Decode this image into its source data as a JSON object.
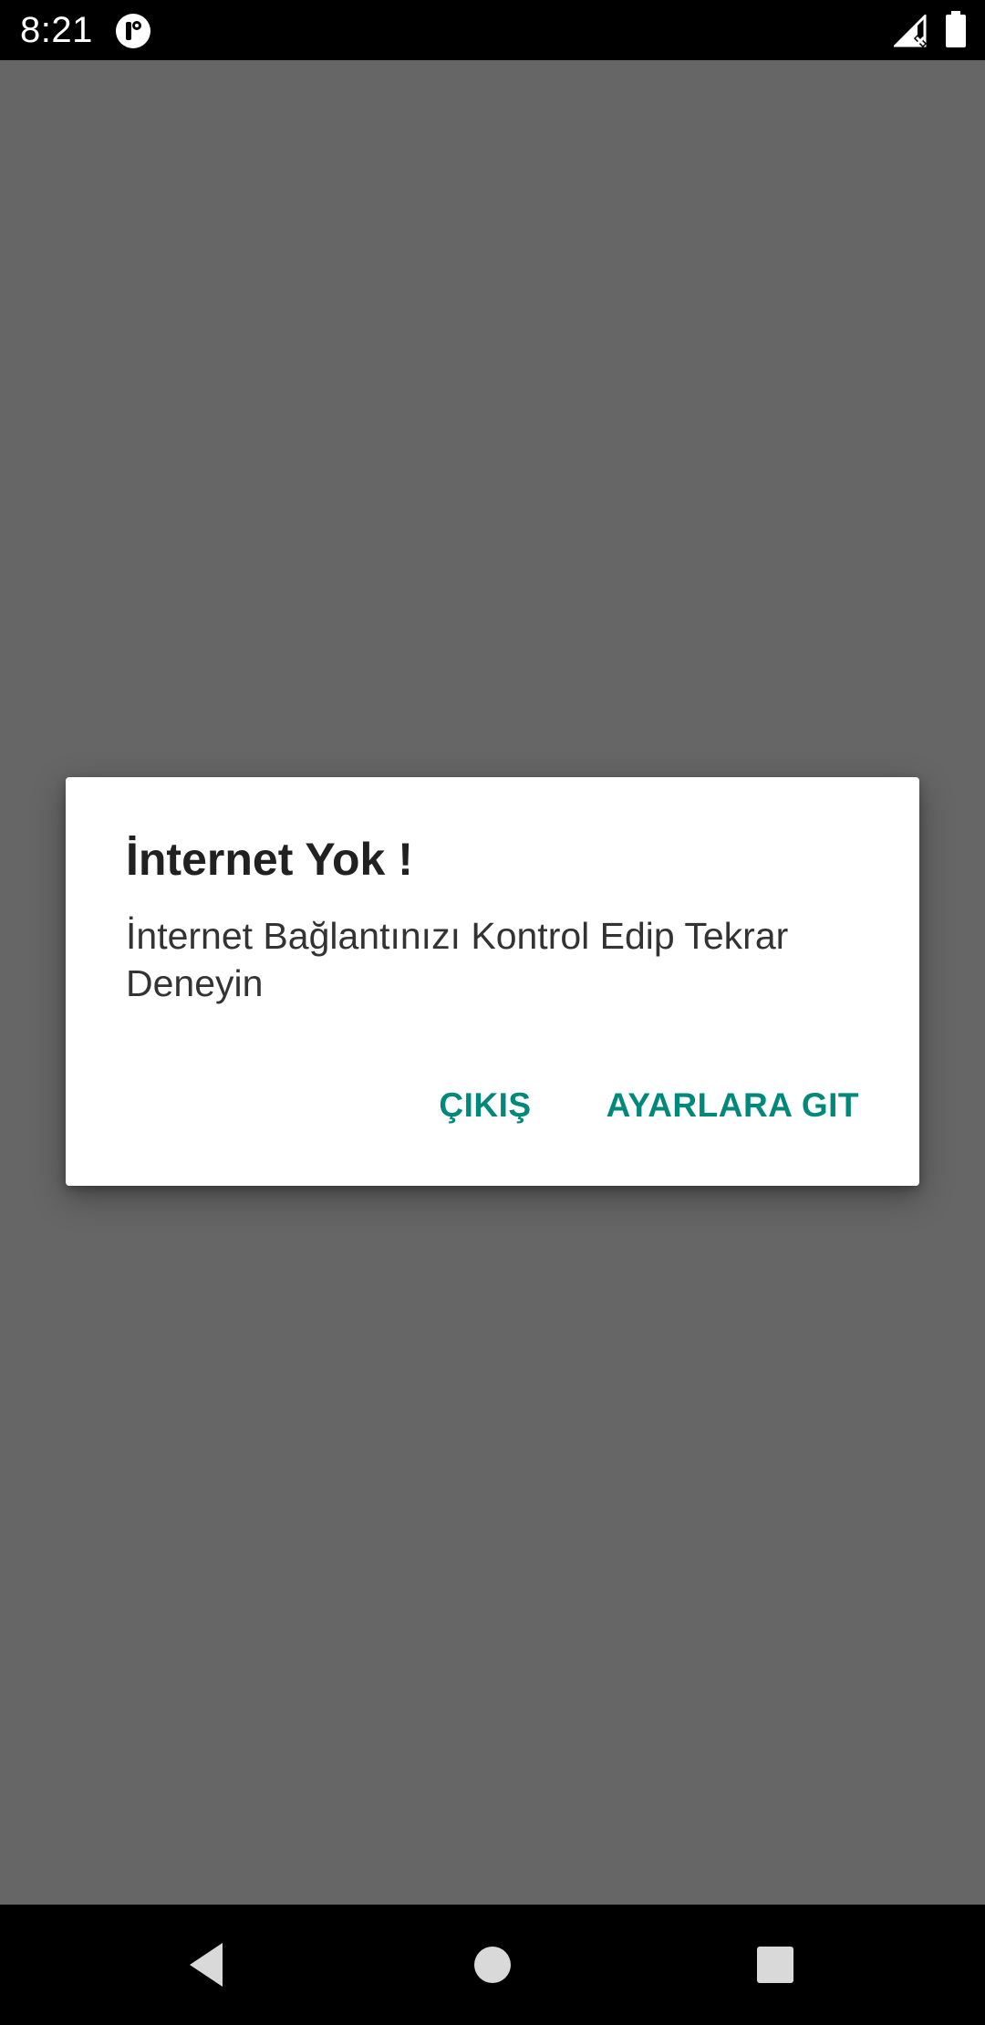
{
  "status_bar": {
    "time": "8:21",
    "app_icon": "notification-app-icon",
    "signal_icon": "signal-no-service-icon",
    "battery_icon": "battery-full-icon"
  },
  "dialog": {
    "title": "İnternet Yok !",
    "message": "İnternet Bağlantınızı Kontrol Edip Tekrar Deneyin",
    "buttons": {
      "exit_label": "ÇIKIŞ",
      "settings_label": "AYARLARA GIT"
    },
    "accent_color": "#00897b"
  },
  "nav_bar": {
    "back_icon": "back-triangle-icon",
    "home_icon": "home-circle-icon",
    "recents_icon": "recents-square-icon"
  },
  "colors": {
    "scrim": "#666666",
    "bars": "#000000",
    "dialog_bg": "#ffffff"
  }
}
